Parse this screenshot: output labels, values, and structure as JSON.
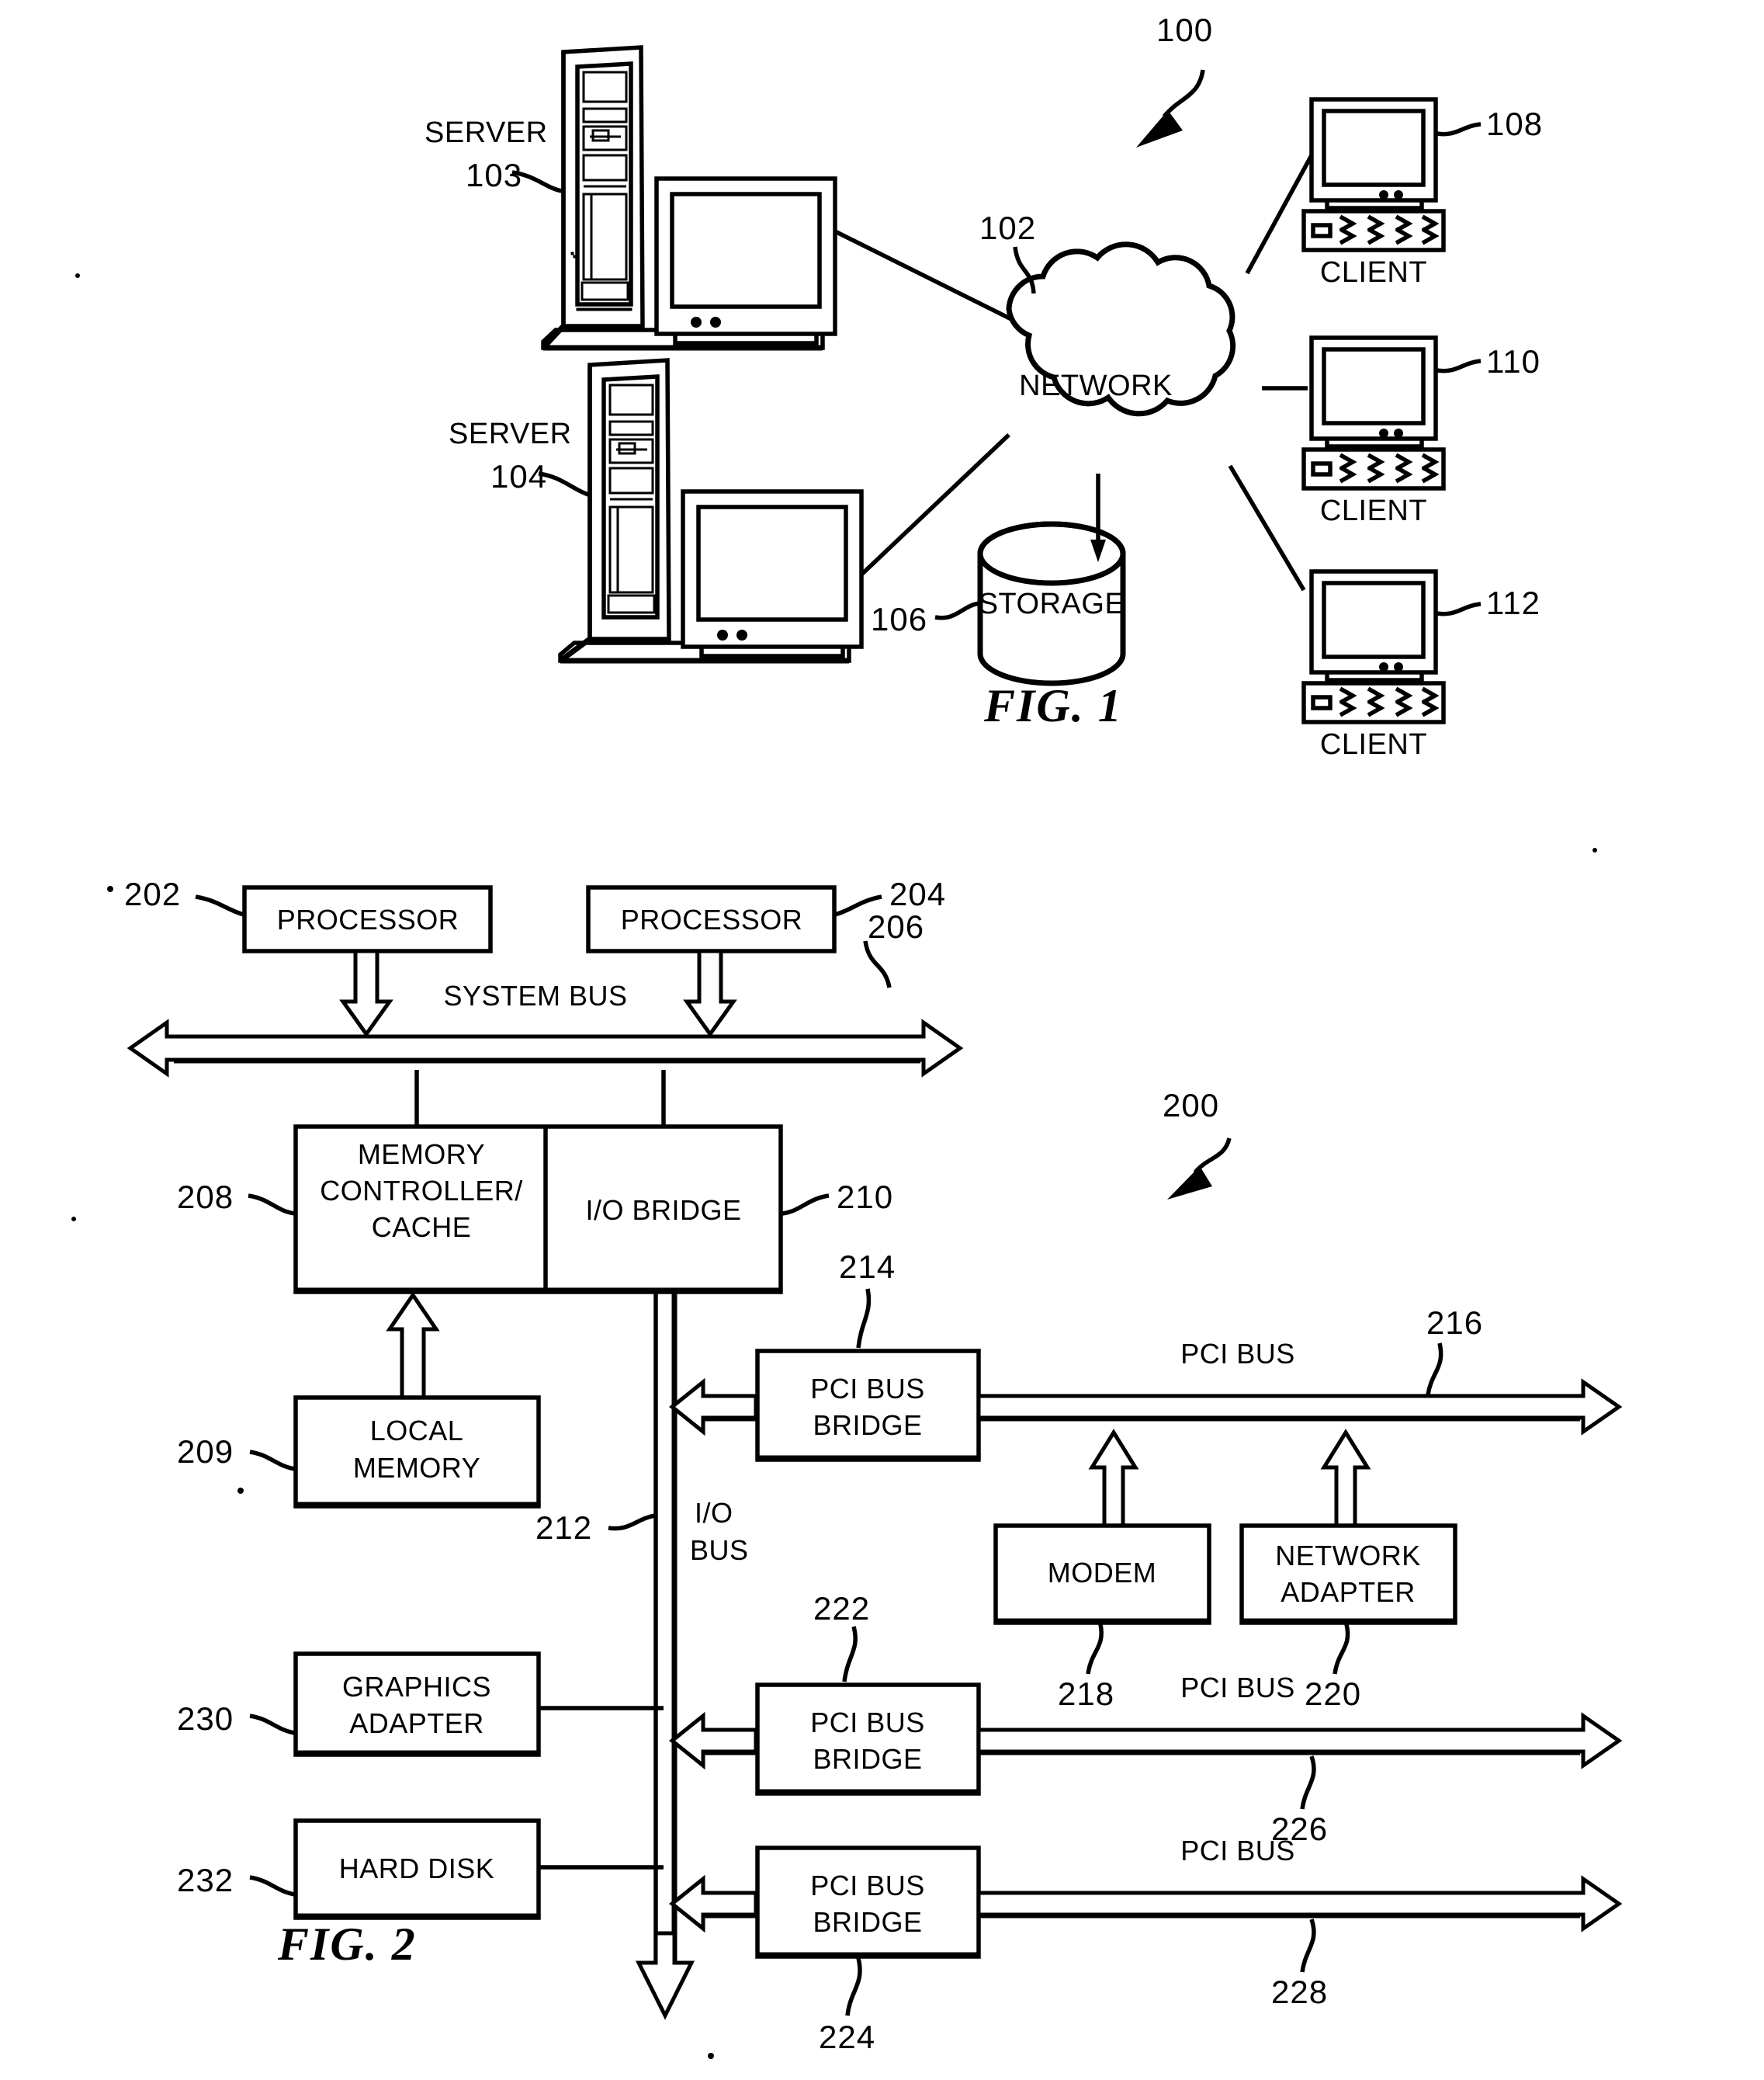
{
  "document": {
    "type": "patent-drawing-sheet",
    "figures": [
      "FIG. 1",
      "FIG. 2"
    ]
  },
  "fig1": {
    "caption": "FIG. 1",
    "system_ref": "100",
    "network": {
      "label": "NETWORK",
      "ref": "102"
    },
    "storage": {
      "label": "STORAGE",
      "ref": "106"
    },
    "servers": [
      {
        "label": "SERVER",
        "ref": "103"
      },
      {
        "label": "SERVER",
        "ref": "104"
      }
    ],
    "clients": [
      {
        "label": "CLIENT",
        "ref": "108"
      },
      {
        "label": "CLIENT",
        "ref": "110"
      },
      {
        "label": "CLIENT",
        "ref": "112"
      }
    ]
  },
  "fig2": {
    "caption": "FIG. 2",
    "system_ref": "200",
    "blocks": [
      {
        "id": "processor1",
        "label": "PROCESSOR",
        "ref": "202"
      },
      {
        "id": "processor2",
        "label": "PROCESSOR",
        "ref": "204"
      },
      {
        "id": "memory_controller",
        "label": "MEMORY CONTROLLER/ CACHE",
        "ref": "208"
      },
      {
        "id": "io_bridge",
        "label": "I/O BRIDGE",
        "ref": "210"
      },
      {
        "id": "local_memory",
        "label": "LOCAL MEMORY",
        "ref": "209"
      },
      {
        "id": "pci_bus_bridge1",
        "label": "PCI BUS BRIDGE",
        "ref": "214"
      },
      {
        "id": "modem",
        "label": "MODEM",
        "ref": "218"
      },
      {
        "id": "network_adapter",
        "label": "NETWORK ADAPTER",
        "ref": "220"
      },
      {
        "id": "pci_bus_bridge2",
        "label": "PCI BUS BRIDGE",
        "ref": "222"
      },
      {
        "id": "pci_bus_bridge3",
        "label": "PCI BUS BRIDGE",
        "ref": "224"
      },
      {
        "id": "graphics_adapter",
        "label": "GRAPHICS ADAPTER",
        "ref": "230"
      },
      {
        "id": "hard_disk",
        "label": "HARD DISK",
        "ref": "232"
      }
    ],
    "buses": [
      {
        "id": "system_bus",
        "label": "SYSTEM BUS",
        "ref": "206"
      },
      {
        "id": "io_bus",
        "label": "I/O BUS",
        "ref": "212"
      },
      {
        "id": "pci_bus1",
        "label": "PCI BUS",
        "ref": "216"
      },
      {
        "id": "pci_bus2",
        "label": "PCI BUS",
        "ref": "226"
      },
      {
        "id": "pci_bus3",
        "label": "PCI BUS",
        "ref": "228"
      }
    ],
    "block_text": {
      "processor1": "PROCESSOR",
      "processor2": "PROCESSOR",
      "memory_controller_l1": "MEMORY",
      "memory_controller_l2": "CONTROLLER/",
      "memory_controller_l3": "CACHE",
      "io_bridge": "I/O BRIDGE",
      "local_memory_l1": "LOCAL",
      "local_memory_l2": "MEMORY",
      "pci_bridge_l1": "PCI BUS",
      "pci_bridge_l2": "BRIDGE",
      "modem": "MODEM",
      "network_adapter_l1": "NETWORK",
      "network_adapter_l2": "ADAPTER",
      "graphics_adapter_l1": "GRAPHICS",
      "graphics_adapter_l2": "ADAPTER",
      "hard_disk": "HARD DISK",
      "io_bus_l1": "I/O",
      "io_bus_l2": "BUS",
      "system_bus": "SYSTEM BUS",
      "pci_bus": "PCI BUS"
    },
    "refs": {
      "r200": "200",
      "r202": "202",
      "r204": "204",
      "r206": "206",
      "r208": "208",
      "r209": "209",
      "r210": "210",
      "r212": "212",
      "r214": "214",
      "r216": "216",
      "r218": "218",
      "r220": "220",
      "r222": "222",
      "r224": "224",
      "r226": "226",
      "r228": "228",
      "r230": "230",
      "r232": "232"
    }
  },
  "colors": {
    "ink": "#000000",
    "paper": "#ffffff"
  }
}
